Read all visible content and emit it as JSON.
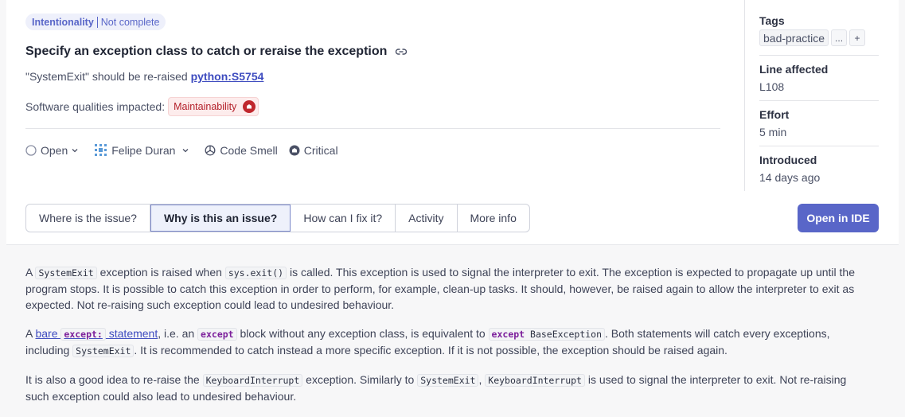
{
  "issue": {
    "chip": {
      "attribute": "Intentionality",
      "status": "Not complete"
    },
    "title": "Specify an exception class to catch or reraise the exception",
    "subtitle": {
      "text": "\"SystemExit\" should be re-raised",
      "rule": "python:S5754"
    },
    "qualities": {
      "label": "Software qualities impacted:",
      "badge": "Maintainability"
    },
    "meta": {
      "status": "Open",
      "assignee": "Felipe Duran",
      "type": "Code Smell",
      "severity": "Critical"
    }
  },
  "sidebar": {
    "tags_label": "Tags",
    "tag": "bad-practice",
    "more": "...",
    "add": "+",
    "line_label": "Line affected",
    "line_value": "L108",
    "effort_label": "Effort",
    "effort_value": "5 min",
    "introduced_label": "Introduced",
    "introduced_value": "14 days ago"
  },
  "tabs": [
    {
      "label": "Where is the issue?"
    },
    {
      "label": "Why is this an issue?"
    },
    {
      "label": "How can I fix it?"
    },
    {
      "label": "Activity"
    },
    {
      "label": "More info"
    }
  ],
  "open_ide": "Open in IDE",
  "content": {
    "p1": {
      "t1": "A ",
      "c1": "SystemExit",
      "t2": " exception is raised when ",
      "c2": "sys.exit()",
      "t3": " is called. This exception is used to signal the interpreter to exit. The exception is expected to propagate up until the program stops. It is possible to catch this exception in order to perform, for example, clean-up tasks. It should, however, be raised again to allow the interpreter to exit as expected. Not re-raising such exception could lead to undesired behaviour."
    },
    "p2": {
      "t1": "A ",
      "link_a": "bare ",
      "link_kw": "except:",
      "link_b": " statement",
      "t2": ", i.e. an ",
      "c1": "except",
      "t3": " block without any exception class, is equivalent to ",
      "c2_kw": "except",
      "c2_rest": " BaseException",
      "t4": ". Both statements will catch every exceptions, including ",
      "c3": "SystemExit",
      "t5": ". It is recommended to catch instead a more specific exception. If it is not possible, the exception should be raised again."
    },
    "p3": {
      "t1": "It is also a good idea to re-raise the ",
      "c1": "KeyboardInterrupt",
      "t2": " exception. Similarly to ",
      "c2": "SystemExit",
      "t3": ", ",
      "c3": "KeyboardInterrupt",
      "t4": " is used to signal the interpreter to exit. Not re-raising such exception could also lead to undesired behaviour."
    }
  }
}
